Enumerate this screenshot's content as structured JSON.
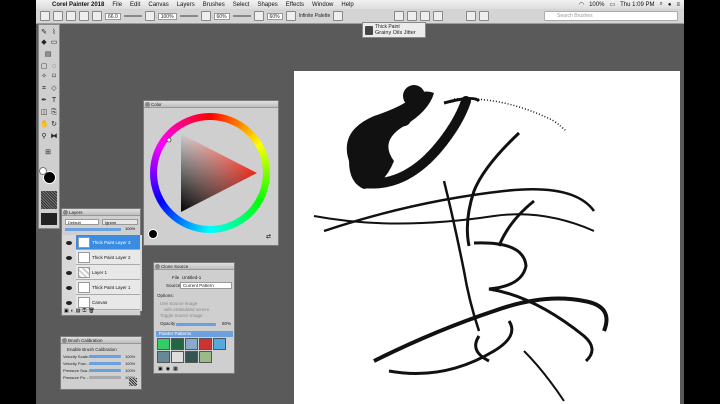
{
  "menubar": {
    "apple": "",
    "app_name": "Corel Painter 2018",
    "items": [
      "File",
      "Edit",
      "Canvas",
      "Layers",
      "Brushes",
      "Select",
      "Shapes",
      "Effects",
      "Window",
      "Help"
    ],
    "battery": "100%",
    "clock": "Thu 1:09 PM"
  },
  "propbar": {
    "size_value": "66.0",
    "opacity_value": "100%",
    "grain_value": "60%",
    "blend_value": "60%",
    "mode_label": "Infinite Palette"
  },
  "search": {
    "placeholder": "Search Brushes"
  },
  "brush_selector": {
    "category": "Thick Paint",
    "variant": "Grainy Oils Jitter"
  },
  "color_panel": {
    "title": "Color"
  },
  "layers_panel": {
    "title": "Layers",
    "composite": "Default",
    "opacity_label": "Ignore",
    "opacity_value": "100%",
    "layers": [
      {
        "name": "Thick Paint Layer 3",
        "selected": true
      },
      {
        "name": "Thick Paint Layer 2",
        "selected": false
      },
      {
        "name": "Layer 1",
        "selected": false
      },
      {
        "name": "Thick Paint Layer 1",
        "selected": false
      },
      {
        "name": "Canvas",
        "selected": false
      }
    ]
  },
  "clone_panel": {
    "title": "Clone Source",
    "file_label": "File",
    "file_value": "Untitled-1",
    "source_label": "Source",
    "source_value": "Current Pattern",
    "options_label": "Options:",
    "opt1": "Use Source Image",
    "opt2": "with embedded screen",
    "opt3": "Toggle Source Image",
    "opacity_label": "Opacity",
    "opacity_value": "80%",
    "patterns_label": "Painter Patterns"
  },
  "brush_calib_panel": {
    "title": "Brush Calibration",
    "enable_label": "Enable Brush Calibration",
    "rows": [
      {
        "label": "Velocity Scale:",
        "value": "100%"
      },
      {
        "label": "Velocity Pow...",
        "value": "100%"
      },
      {
        "label": "Pressure Sca...",
        "value": "100%"
      },
      {
        "label": "Pressure Po...",
        "value": "100%"
      }
    ]
  },
  "colors": {
    "accent": "#3b8be0",
    "paint": "#111111"
  }
}
